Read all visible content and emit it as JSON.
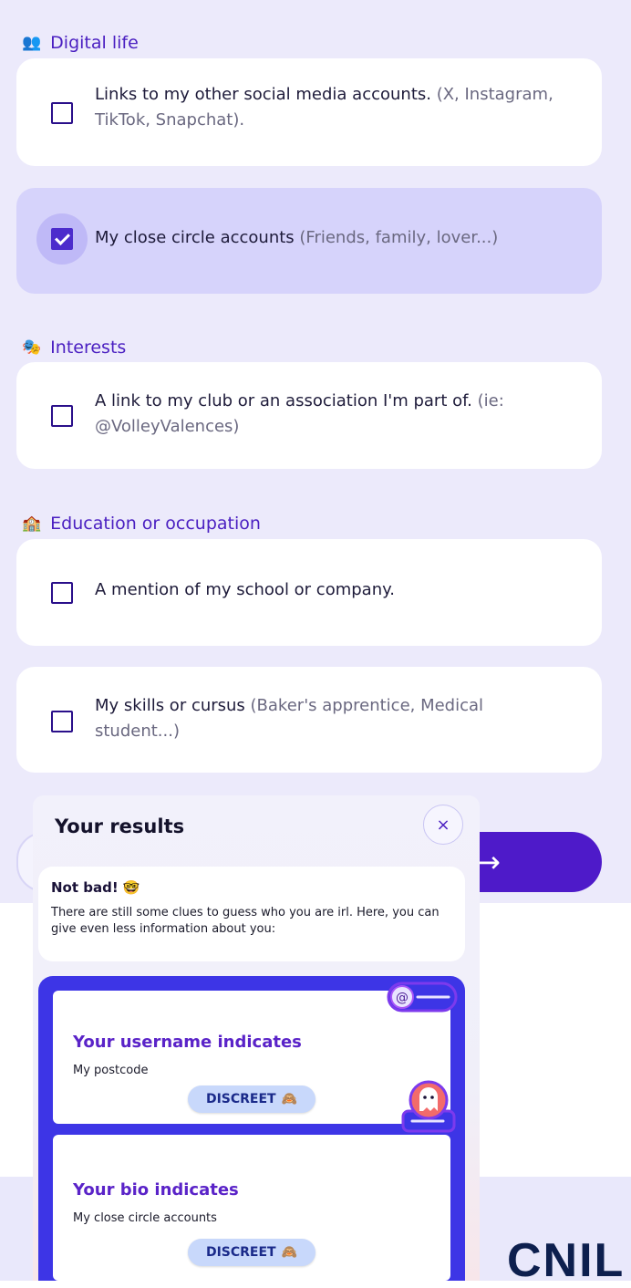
{
  "sections": [
    {
      "icon": "👥",
      "title": "Digital life",
      "items": [
        {
          "text": "Links to my other social media accounts.",
          "hint": " (X, Instagram, TikTok, Snapchat).",
          "checked": false
        },
        {
          "text": "My close circle accounts",
          "hint": " (Friends, family, lover...)",
          "checked": true
        }
      ]
    },
    {
      "icon": "🎭",
      "title": "Interests",
      "items": [
        {
          "text": "A link to my club or an association I'm part of.",
          "hint": " (ie: @VolleyValences)",
          "checked": false
        }
      ]
    },
    {
      "icon": "🏫",
      "title": "Education or occupation",
      "items": [
        {
          "text": "A mention of my school or company.",
          "hint": "",
          "checked": false
        },
        {
          "text": "My skills or cursus",
          "hint": " (Baker's apprentice, Medical student...)",
          "checked": false
        }
      ]
    }
  ],
  "under_button": {
    "arrow": "→"
  },
  "results": {
    "title": "Your results",
    "close_label": "×",
    "summary_title": "Not bad! 🤓",
    "summary_text": "There are still some clues to guess who you are irl. Here, you can give even less information about you:",
    "cards": [
      {
        "title": "Your username indicates",
        "subtitle": "My postcode",
        "badge": "DISCREET",
        "badge_emoji": "🙈"
      },
      {
        "title": "Your bio indicates",
        "subtitle": "My close circle accounts",
        "badge": "DISCREET",
        "badge_emoji": "🙈"
      }
    ]
  },
  "footer": {
    "logo": "CNIL"
  }
}
